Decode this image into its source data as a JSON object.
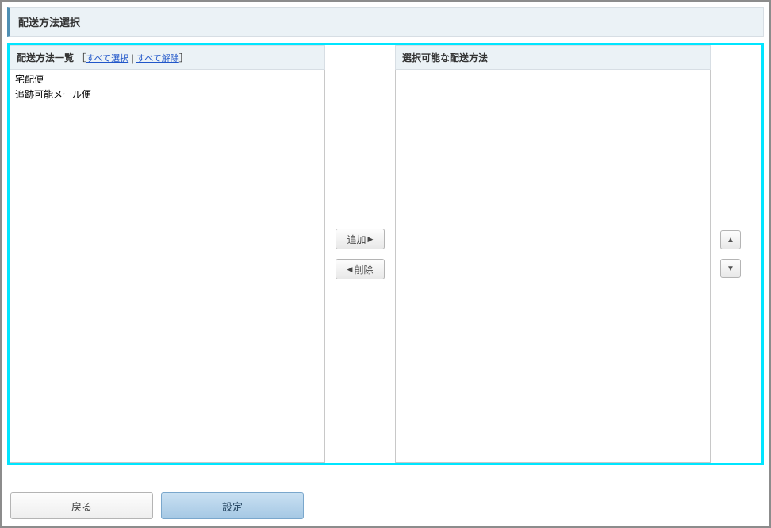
{
  "header": {
    "title": "配送方法選択"
  },
  "left_panel": {
    "title": "配送方法一覧",
    "bracket_open": "［",
    "bracket_close": "］",
    "separator": " | ",
    "select_all": "すべて選択",
    "deselect_all": "すべて解除",
    "items": [
      "宅配便",
      "追跡可能メール便"
    ]
  },
  "mid": {
    "add_label": "追加",
    "remove_label": "削除"
  },
  "right_panel": {
    "title": "選択可能な配送方法",
    "items": []
  },
  "footer": {
    "back_label": "戻る",
    "submit_label": "設定"
  }
}
